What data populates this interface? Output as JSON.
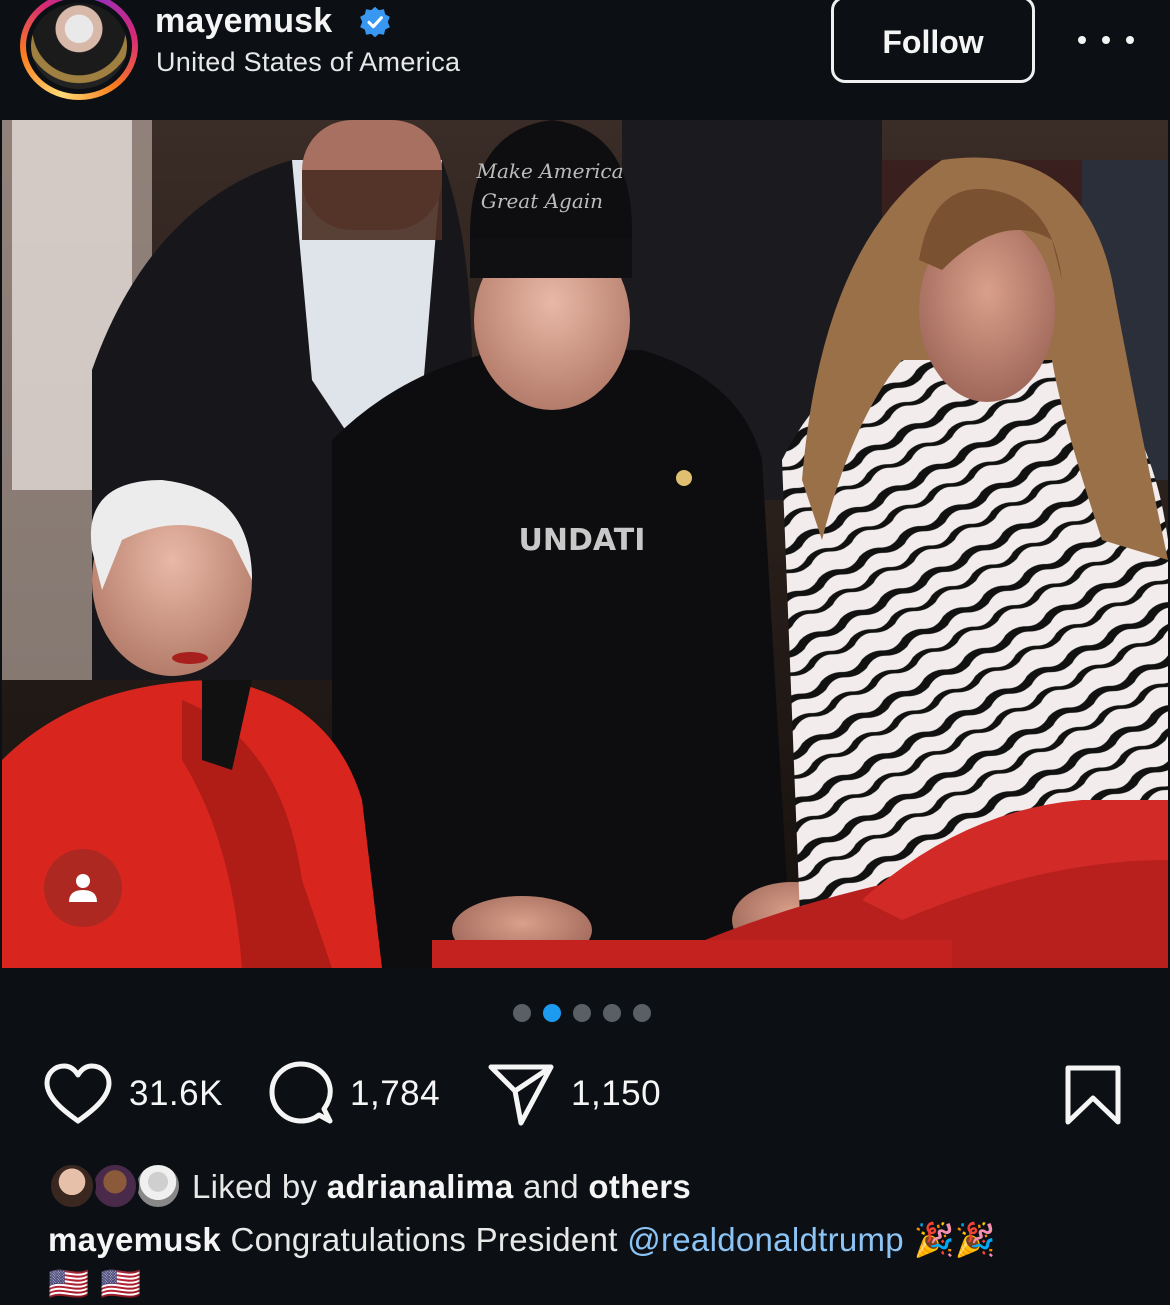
{
  "post": {
    "username": "mayemusk",
    "verified": true,
    "location": "United States of America",
    "follow_label": "Follow",
    "more_icon": "more-icon"
  },
  "photo": {
    "hat_text_line1": "Make America",
    "hat_text_line2": "Great Again",
    "shirt_text": "UNDATI",
    "tag_icon": "person-icon"
  },
  "carousel": {
    "total": 5,
    "active_index": 1
  },
  "actions": {
    "likes_count": "31.6K",
    "comments_count": "1,784",
    "shares_count": "1,150"
  },
  "likes": {
    "prefix": "Liked by",
    "user": "adrianalima",
    "middle": "and",
    "suffix": "others"
  },
  "caption": {
    "username": "mayemusk",
    "text": "Congratulations President",
    "mention": "@realdonaldtrump",
    "party_emoji": "🎉🎉",
    "flags": "🇺🇸 🇺🇸"
  },
  "colors": {
    "background": "#0c1014",
    "accent_blue": "#1d9bf0",
    "mention": "#8cc4f5"
  }
}
